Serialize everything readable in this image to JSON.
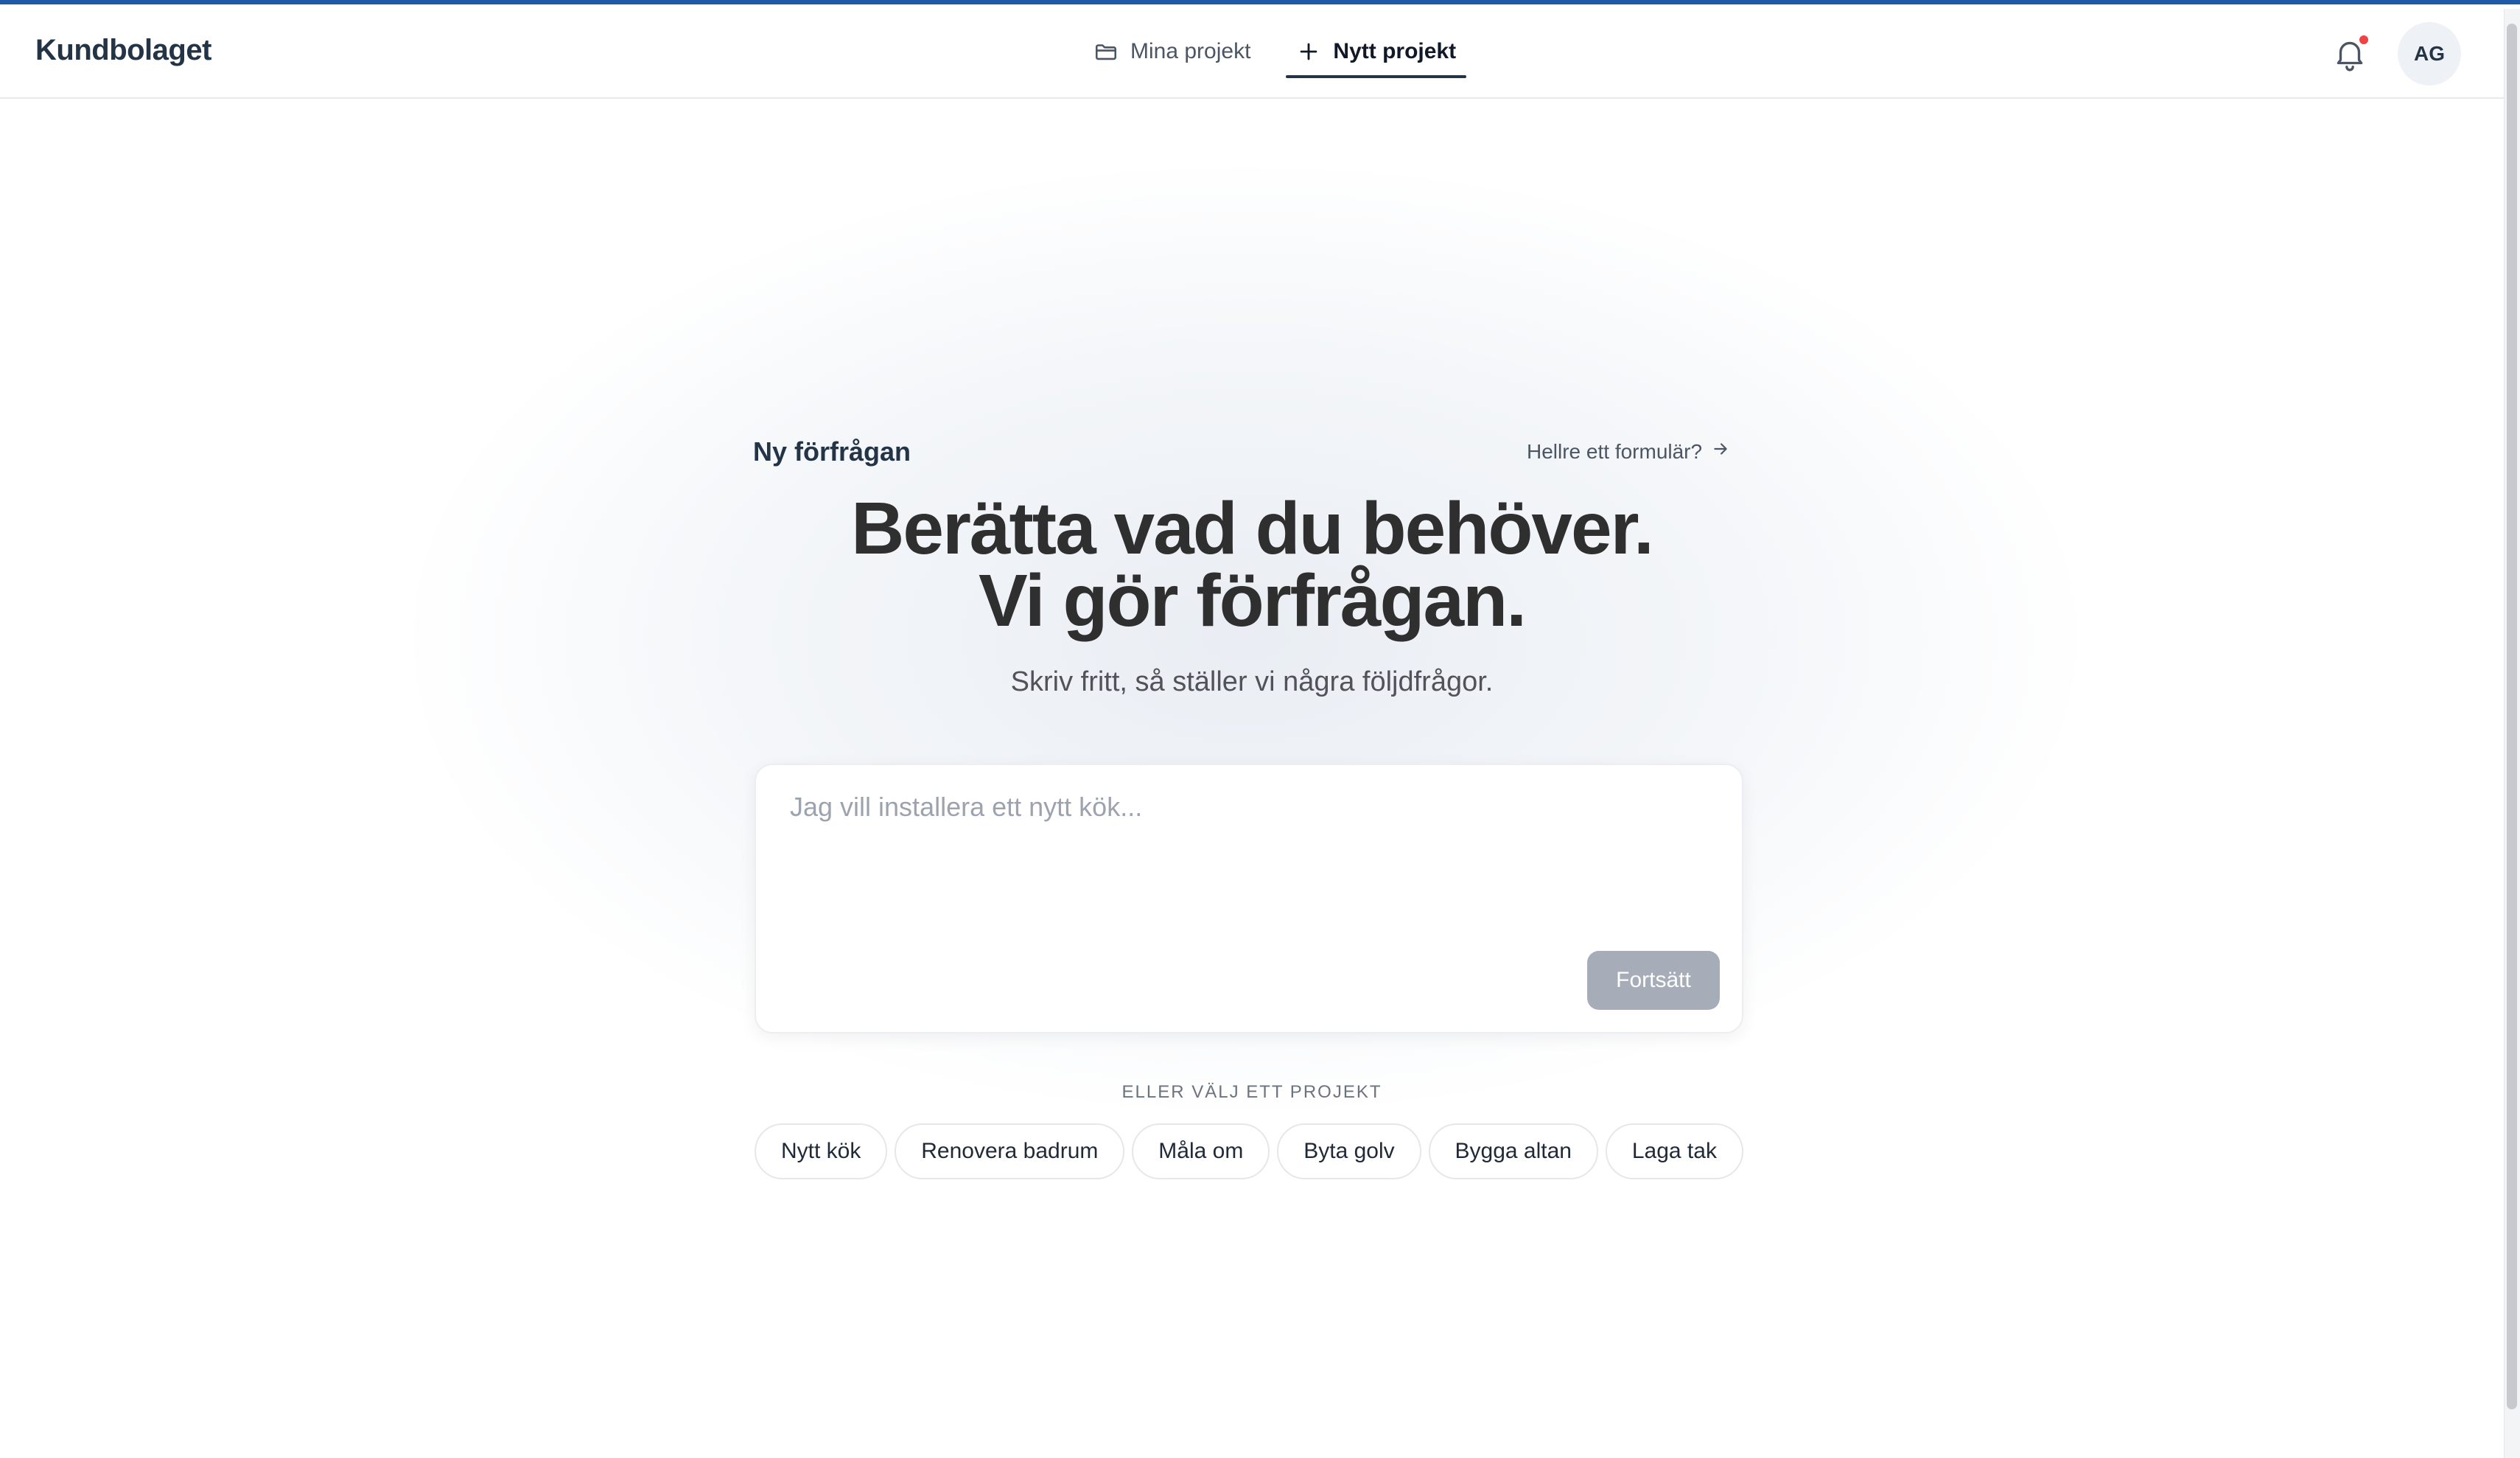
{
  "app": {
    "brand": "Kundbolaget"
  },
  "nav": {
    "items": [
      {
        "label": "Mina projekt",
        "icon": "folder-icon",
        "active": false
      },
      {
        "label": "Nytt projekt",
        "icon": "plus-icon",
        "active": true
      }
    ]
  },
  "header": {
    "notifications_icon": "bell-icon",
    "has_unread": true,
    "avatar_initials": "AG"
  },
  "main": {
    "section_label": "Ny förfrågan",
    "form_link": "Hellre ett formulär?",
    "form_link_icon": "arrow-right-icon",
    "headline_line1": "Berätta vad du behöver.",
    "headline_line2": "Vi gör förfrågan.",
    "subtitle": "Skriv fritt, så ställer vi några följdfrågor.",
    "prompt": {
      "value": "",
      "placeholder": "Jag vill installera ett nytt kök..."
    },
    "continue_label": "Fortsätt",
    "or_label": "ELLER VÄLJ ETT PROJEKT",
    "chips": [
      "Nytt kök",
      "Renovera badrum",
      "Måla om",
      "Byta golv",
      "Bygga altan",
      "Laga tak"
    ]
  },
  "colors": {
    "accent": "#1e5aa8",
    "brand_text": "#243447",
    "button_disabled": "#a6adb9",
    "notification_dot": "#ef4444"
  }
}
